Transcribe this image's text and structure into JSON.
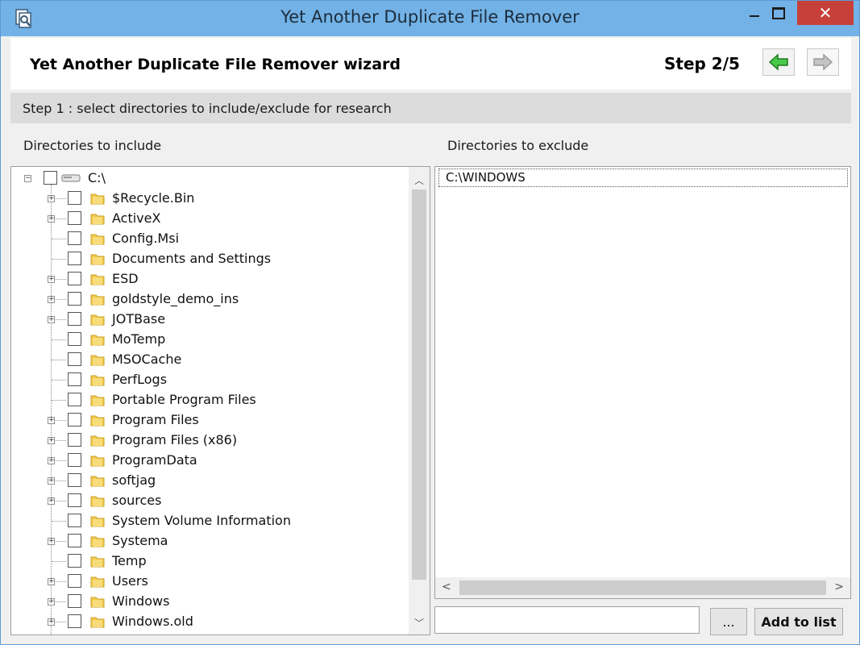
{
  "window": {
    "title": "Yet Another Duplicate File Remover",
    "close_glyph": "✕"
  },
  "header": {
    "wizard_title": "Yet Another Duplicate File Remover wizard",
    "step_label": "Step 2/5"
  },
  "step_banner": "Step 1 : select directories  to include/exclude for research",
  "include": {
    "label": "Directories to include",
    "root": {
      "label": "C:\\",
      "expander": "−"
    },
    "items": [
      {
        "label": "$Recycle.Bin",
        "expandable": true
      },
      {
        "label": "ActiveX",
        "expandable": true
      },
      {
        "label": "Config.Msi",
        "expandable": false
      },
      {
        "label": "Documents and Settings",
        "expandable": false
      },
      {
        "label": "ESD",
        "expandable": true
      },
      {
        "label": "goldstyle_demo_ins",
        "expandable": true
      },
      {
        "label": "JOTBase",
        "expandable": true
      },
      {
        "label": "MoTemp",
        "expandable": false
      },
      {
        "label": "MSOCache",
        "expandable": false
      },
      {
        "label": "PerfLogs",
        "expandable": false
      },
      {
        "label": "Portable Program Files",
        "expandable": false
      },
      {
        "label": "Program Files",
        "expandable": true
      },
      {
        "label": "Program Files (x86)",
        "expandable": true
      },
      {
        "label": "ProgramData",
        "expandable": true
      },
      {
        "label": "softjag",
        "expandable": true
      },
      {
        "label": "sources",
        "expandable": true
      },
      {
        "label": "System Volume Information",
        "expandable": false
      },
      {
        "label": "Systema",
        "expandable": true
      },
      {
        "label": "Temp",
        "expandable": false
      },
      {
        "label": "Users",
        "expandable": true
      },
      {
        "label": "Windows",
        "expandable": true
      },
      {
        "label": "Windows.old",
        "expandable": true
      }
    ]
  },
  "exclude": {
    "label": "Directories to exclude",
    "items": [
      "C:\\WINDOWS"
    ]
  },
  "path_input": {
    "value": ""
  },
  "buttons": {
    "browse": "...",
    "add": "Add to list"
  },
  "colors": {
    "titlebar": "#72b2e6",
    "close": "#c7403a",
    "folder": "#f2c94c"
  }
}
